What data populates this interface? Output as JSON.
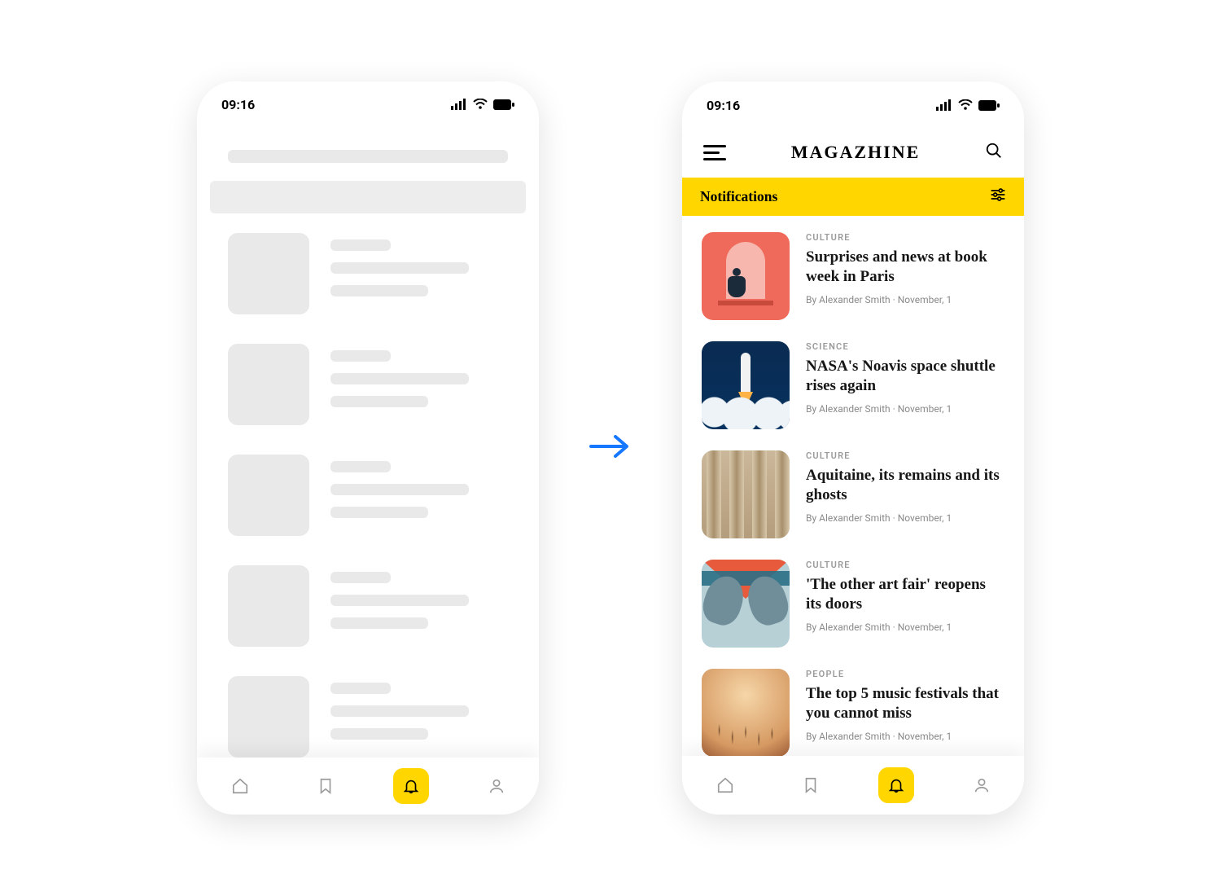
{
  "status": {
    "time": "09:16"
  },
  "header": {
    "brand": "MAGAZHINE"
  },
  "section": {
    "title": "Notifications"
  },
  "articles": [
    {
      "category": "CULTURE",
      "title": "Surprises and news at book week in Paris",
      "author": "By Alexander Smith",
      "date": "November, 1"
    },
    {
      "category": "SCIENCE",
      "title": "NASA's Noavis space shuttle rises again",
      "author": "By Alexander Smith",
      "date": "November, 1"
    },
    {
      "category": "CULTURE",
      "title": "Aquitaine, its remains and its ghosts",
      "author": "By Alexander Smith",
      "date": "November, 1"
    },
    {
      "category": "CULTURE",
      "title": "'The other art fair' reopens its doors",
      "author": "By Alexander Smith",
      "date": "November, 1"
    },
    {
      "category": "PEOPLE",
      "title": "The top 5 music festivals that you cannot miss",
      "author": "By Alexander Smith",
      "date": "November, 1"
    }
  ],
  "nav": {
    "items": [
      "home",
      "bookmark",
      "notifications",
      "profile"
    ],
    "active": "notifications"
  }
}
